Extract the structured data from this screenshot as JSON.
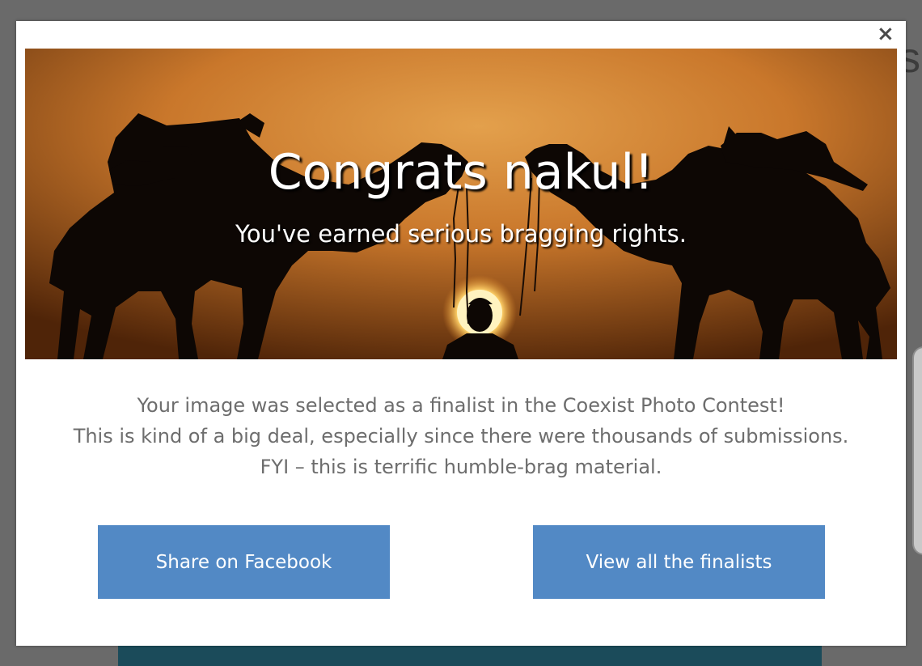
{
  "background": {
    "edge_text": "s"
  },
  "modal": {
    "close_label": "×",
    "hero": {
      "title": "Congrats nakul!",
      "subtitle": "You've earned serious bragging rights."
    },
    "message_lines": [
      "Your image was selected as a finalist in the Coexist Photo Contest!",
      "This is kind of a big deal, especially since there were thousands of submissions.",
      "FYI – this is terrific humble-brag material."
    ],
    "buttons": {
      "share_label": "Share on Facebook",
      "view_label": "View all the finalists"
    }
  },
  "colors": {
    "button_bg": "#5289c5",
    "message_text": "#6d6d6d",
    "overlay": "#6a6a6a"
  }
}
